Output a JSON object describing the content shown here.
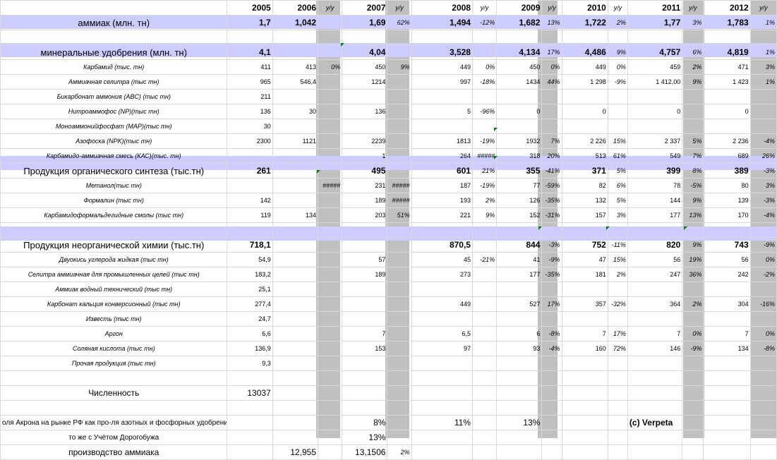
{
  "header": [
    "",
    "2005",
    "2006",
    "y/y",
    "2007",
    "y/y",
    "2008",
    "y/y",
    "2009",
    "y/y",
    "2010",
    "y/y",
    "2011",
    "y/y",
    "2012",
    "y/y"
  ],
  "rows": [
    {
      "cells": [
        "аммиак (млн. тн)",
        "1,7",
        "1,042",
        "",
        "1,69",
        "62%",
        "1,494",
        "-12%",
        "1,682",
        "13%",
        "1,722",
        "2%",
        "1,77",
        "3%",
        "1,783",
        "1%"
      ]
    },
    {
      "cells": [
        "",
        "",
        "",
        "",
        "",
        "",
        "",
        "",
        "",
        "",
        "",
        "",
        "",
        "",
        "",
        ""
      ]
    },
    {
      "cells": [
        "минеральные удобрения (млн. тн)",
        "4,1",
        "",
        "",
        "4,04",
        "",
        "3,528",
        "",
        "4,134",
        "17%",
        "4,486",
        "9%",
        "4,757",
        "6%",
        "4,819",
        "1%"
      ]
    },
    {
      "cells": [
        "Карбамид (тыс. тн)",
        "411",
        "413",
        "0%",
        "450",
        "9%",
        "449",
        "0%",
        "450",
        "0%",
        "449",
        "0%",
        "459",
        "2%",
        "471",
        "3%"
      ]
    },
    {
      "cells": [
        "Аммиачная селитра (тыс тн)",
        "965",
        "546,4",
        "",
        "1214",
        "",
        "997",
        "-18%",
        "1434",
        "44%",
        "1 298",
        "-9%",
        "1 412,00",
        "9%",
        "1 423",
        "1%"
      ]
    },
    {
      "cells": [
        "Бикарбонат аммония (ABC) (тыс тн)",
        "211",
        "",
        "",
        "",
        "",
        "",
        "",
        "",
        "",
        "",
        "",
        "",
        "",
        "",
        ""
      ]
    },
    {
      "cells": [
        "Нитроаммофос (NP)(тыс тн)",
        "136",
        "30",
        "",
        "136",
        "",
        "5",
        "-96%",
        "0",
        "",
        "0",
        "",
        "0",
        "",
        "0",
        ""
      ]
    },
    {
      "cells": [
        "Моноаммонийфосфат (MAP)(тыс тн)",
        "30",
        "",
        "",
        "",
        "",
        "",
        "",
        "",
        "",
        "",
        "",
        "",
        "",
        "",
        ""
      ]
    },
    {
      "cells": [
        "Азофоска (NPK)(тыс тн)",
        "2300",
        "1121",
        "",
        "2239",
        "",
        "1813",
        "-19%",
        "1932",
        "7%",
        "2 226",
        "15%",
        "2 337",
        "5%",
        "2 236",
        "-4%"
      ]
    },
    {
      "cells": [
        "Карбамидо-аммиачная смесь (КАС)(тыс. тн)",
        "",
        "",
        "",
        "1",
        "",
        "264",
        "#####",
        "318",
        "20%",
        "513",
        "61%",
        "549",
        "7%",
        "689",
        "26%"
      ]
    },
    {
      "cells": [
        "Продукция органического синтеза (тыс.тн)",
        "261",
        "",
        "",
        "495",
        "",
        "601",
        "21%",
        "355",
        "-41%",
        "371",
        "5%",
        "399",
        "8%",
        "389",
        "-3%"
      ]
    },
    {
      "cells": [
        "Метанол(тыс тн)",
        "",
        "",
        "#####",
        "231",
        "#####",
        "187",
        "-19%",
        "77",
        "-59%",
        "82",
        "6%",
        "78",
        "-5%",
        "80",
        "3%"
      ]
    },
    {
      "cells": [
        "Формалин (тыс тн)",
        "142",
        "",
        "",
        "189",
        "#####",
        "193",
        "2%",
        "126",
        "-35%",
        "132",
        "5%",
        "144",
        "9%",
        "139",
        "-3%"
      ]
    },
    {
      "cells": [
        "Карбамидоформальдегидные смолы (тыс тн)",
        "119",
        "134",
        "",
        "203",
        "51%",
        "221",
        "9%",
        "152",
        "-31%",
        "157",
        "3%",
        "177",
        "13%",
        "170",
        "-4%"
      ]
    },
    {
      "cells": [
        "",
        "",
        "",
        "",
        "",
        "",
        "",
        "",
        "",
        "",
        "",
        "",
        "",
        "",
        "",
        ""
      ]
    },
    {
      "cells": [
        "Продукция неорганической химии (тыс.тн)",
        "718,1",
        "",
        "",
        "",
        "",
        "870,5",
        "",
        "844",
        "-3%",
        "752",
        "-11%",
        "820",
        "9%",
        "743",
        "-9%"
      ]
    },
    {
      "cells": [
        "Двуокись углерода жидкая (тыс тн)",
        "54,9",
        "",
        "",
        "57",
        "",
        "45",
        "-21%",
        "41",
        "-9%",
        "47",
        "15%",
        "56",
        "19%",
        "56",
        "0%"
      ]
    },
    {
      "cells": [
        "Селитра аммиачная для промышленных целей (тыс тн)",
        "183,2",
        "",
        "",
        "189",
        "",
        "273",
        "",
        "177",
        "-35%",
        "181",
        "2%",
        "247",
        "36%",
        "242",
        "-2%"
      ]
    },
    {
      "cells": [
        "Аммиак водный технический (тыс тн)",
        "25,1",
        "",
        "",
        "",
        "",
        "",
        "",
        "",
        "",
        "",
        "",
        "",
        "",
        "",
        ""
      ]
    },
    {
      "cells": [
        "Карбонат кальция конверсионный (тыс тн)",
        "277,4",
        "",
        "",
        "",
        "",
        "449",
        "",
        "527",
        "17%",
        "357",
        "-32%",
        "364",
        "2%",
        "304",
        "-16%"
      ]
    },
    {
      "cells": [
        "Известь (тыс тн)",
        "24,7",
        "",
        "",
        "",
        "",
        "",
        "",
        "",
        "",
        "",
        "",
        "",
        "",
        "",
        ""
      ]
    },
    {
      "cells": [
        "Аргон",
        "6,6",
        "",
        "",
        "7",
        "",
        "6,5",
        "",
        "6",
        "-8%",
        "7",
        "17%",
        "7",
        "0%",
        "7",
        "0%"
      ]
    },
    {
      "cells": [
        "Соляная кислота (тыс тн)",
        "136,9",
        "",
        "",
        "153",
        "",
        "97",
        "",
        "93",
        "-4%",
        "160",
        "72%",
        "146",
        "-9%",
        "134",
        "-8%"
      ]
    },
    {
      "cells": [
        "Прочая продукция (тыс тн)",
        "9,3",
        "",
        "",
        "",
        "",
        "",
        "",
        "",
        "",
        "",
        "",
        "",
        "",
        "",
        ""
      ]
    },
    {
      "cells": [
        "",
        "",
        "",
        "",
        "",
        "",
        "",
        "",
        "",
        "",
        "",
        "",
        "",
        "",
        "",
        ""
      ]
    },
    {
      "cells": [
        "Численность",
        "13037",
        "",
        "",
        "",
        "",
        "",
        "",
        "",
        "",
        "",
        "",
        "",
        "",
        "",
        ""
      ]
    },
    {
      "cells": [
        "",
        "",
        "",
        "",
        "",
        "",
        "",
        "",
        "",
        "",
        "",
        "",
        "",
        "",
        "",
        ""
      ]
    },
    {
      "cells": [
        "оля Акрона на рынке РФ как про-ля азотных и фосфорных удобрени",
        "",
        "",
        "",
        "8%",
        "",
        "11%",
        "",
        "13%",
        "",
        "",
        "",
        "(c) Verpeta",
        "",
        "",
        ""
      ]
    },
    {
      "cells": [
        "то же с Учётом Дорогобужа",
        "",
        "",
        "",
        "13%",
        "",
        "",
        "",
        "",
        "",
        "",
        "",
        "",
        "",
        "",
        ""
      ]
    },
    {
      "cells": [
        "производство аммиака",
        "",
        "12,955",
        "",
        "13,1506",
        "2%",
        "",
        "",
        "",
        "",
        "",
        "",
        "",
        "",
        "",
        ""
      ]
    }
  ],
  "colors": {
    "highlight": "#ccccff",
    "yy_column": "#c0c0c0",
    "comment_flag": "#008000"
  }
}
